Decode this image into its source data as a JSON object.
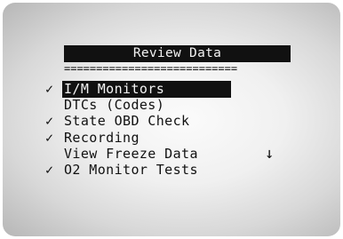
{
  "screen": {
    "title": "Review Data",
    "separator": "==========================="
  },
  "menu": {
    "items": [
      {
        "check": "✓",
        "label": "I/M Monitors"
      },
      {
        "check": "",
        "label": "DTCs (Codes)"
      },
      {
        "check": "✓",
        "label": "State OBD Check"
      },
      {
        "check": "✓",
        "label": "Recording"
      },
      {
        "check": "",
        "label": "View Freeze Data"
      },
      {
        "check": "✓",
        "label": "O2 Monitor Tests"
      }
    ],
    "selected_index": 0
  },
  "scroll_indicator": "↓"
}
